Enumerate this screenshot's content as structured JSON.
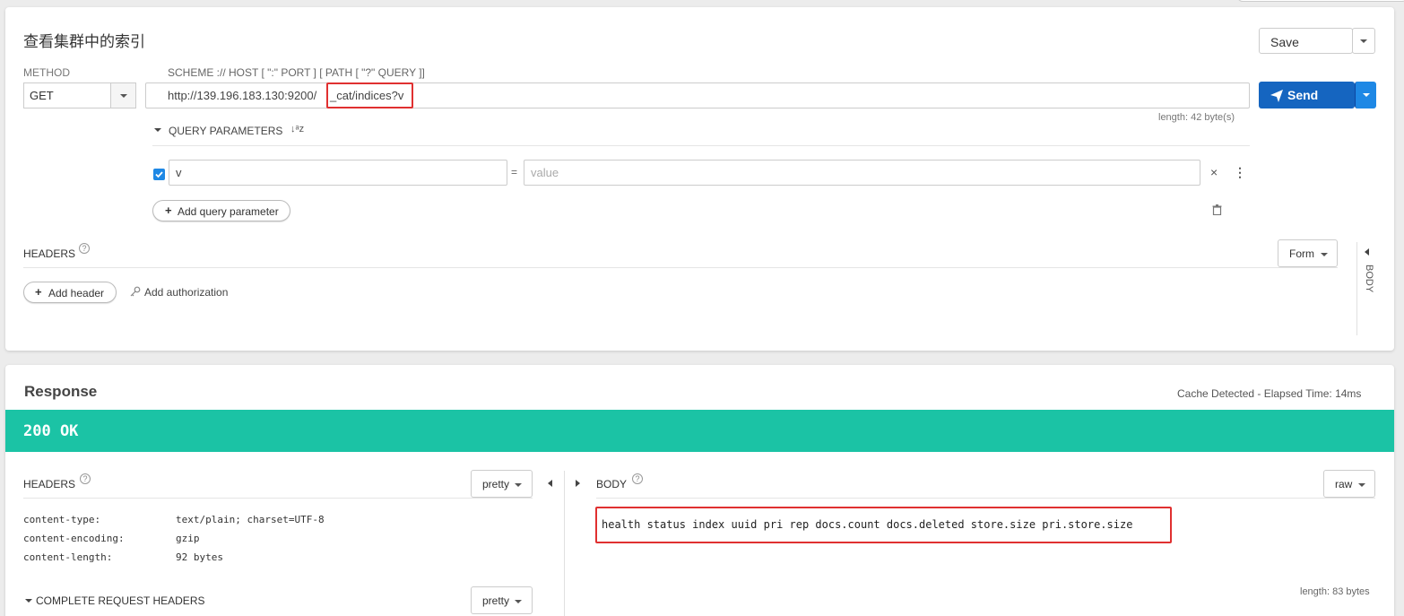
{
  "request": {
    "title": "查看集群中的索引",
    "save_label": "Save",
    "method_label": "METHOD",
    "method_value": "GET",
    "scheme_hint": "SCHEME :// HOST [ \":\" PORT ] [ PATH [ \"?\" QUERY ]]",
    "url_host": "http://139.196.183.130:9200/",
    "url_path": "_cat/indices?v",
    "send_label": "Send",
    "length_text": "length: 42 byte(s)",
    "query_params_label": "QUERY PARAMETERS",
    "sort_glyph": "↓a z",
    "param": {
      "checked": true,
      "name": "v",
      "equals": "=",
      "value_placeholder": "value"
    },
    "add_query_param_label": "Add query parameter",
    "headers_label": "HEADERS",
    "form_label": "Form",
    "body_side_label": "BODY",
    "add_header_label": "Add header",
    "add_authorization_label": "Add authorization"
  },
  "response": {
    "title": "Response",
    "cache_text": "Cache Detected - Elapsed Time: 14ms",
    "status_text": "200 OK",
    "status_color": "#1bc3a5",
    "headers_label": "HEADERS",
    "headers_format": "pretty",
    "headers": [
      {
        "name": "content-type:",
        "value": "text/plain; charset=UTF-8"
      },
      {
        "name": "content-encoding:",
        "value": "gzip"
      },
      {
        "name": "content-length:",
        "value": "92 bytes"
      }
    ],
    "complete_request_headers_label": "COMPLETE REQUEST HEADERS",
    "complete_format": "pretty",
    "body_label": "BODY",
    "body_format": "raw",
    "body_text": "health status index uuid pri rep docs.count docs.deleted store.size pri.store.size",
    "body_length": "length: 83 bytes"
  },
  "colors": {
    "send": "#1565c0",
    "highlight": "#e03030"
  }
}
